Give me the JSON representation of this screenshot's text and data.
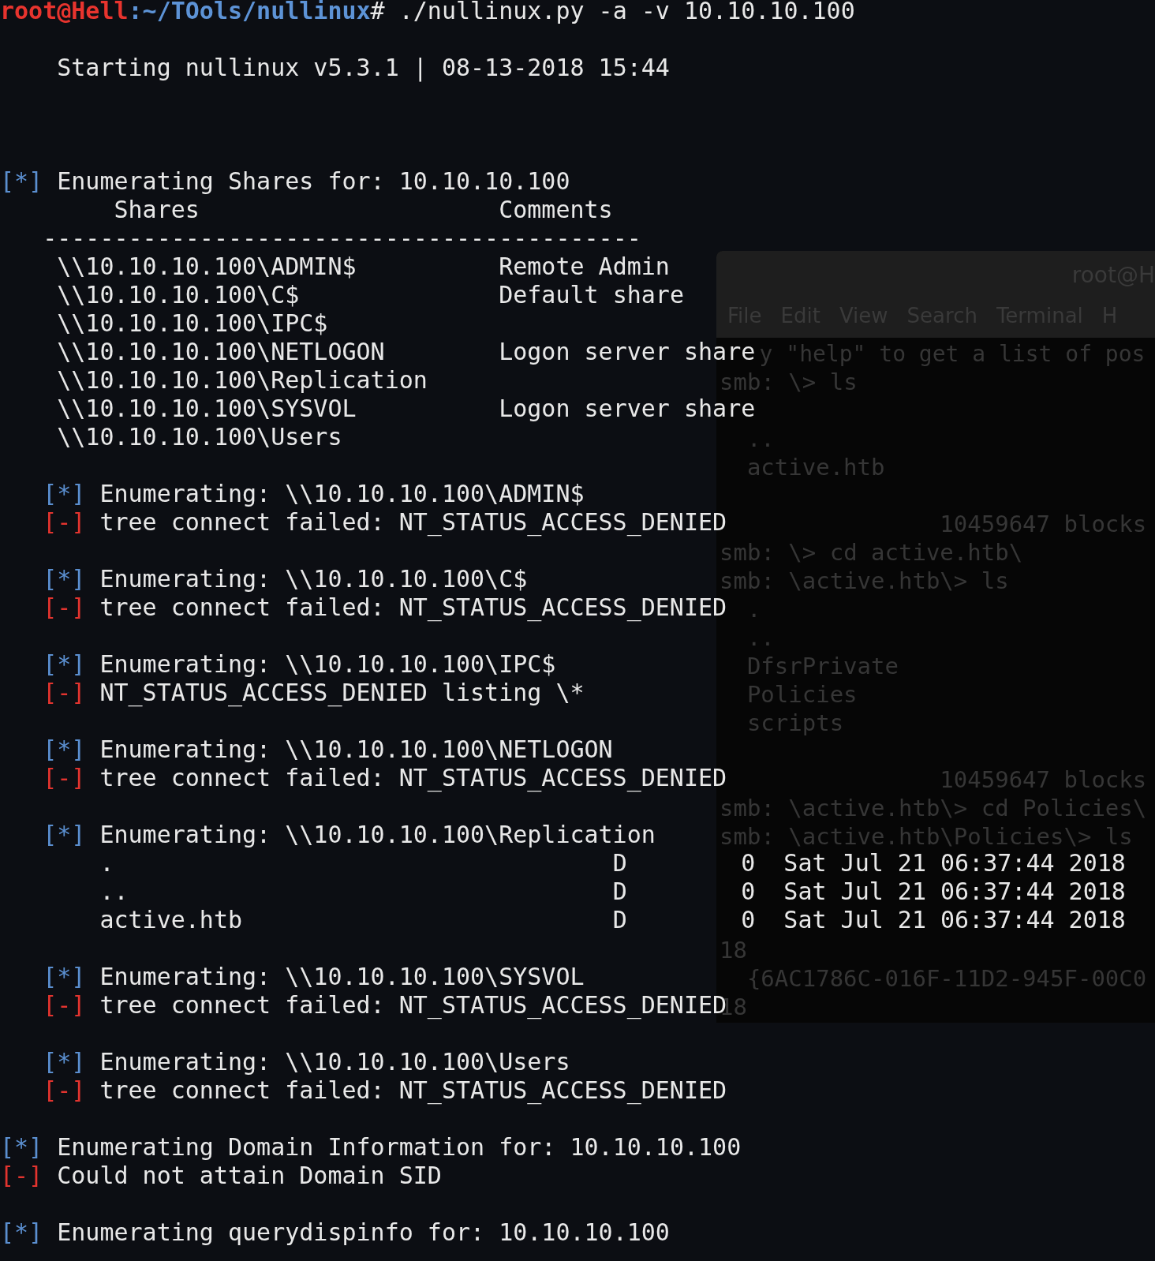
{
  "terminal": {
    "lines": [
      {
        "kind": "prompt",
        "user": "root@Hell",
        "path": ":~/TOols/nullinux",
        "command": "# ./nullinux.py -a -v 10.10.10.100"
      },
      {
        "kind": "blank"
      },
      {
        "kind": "banner",
        "text": "Starting nullinux v5.3.1 | 08-13-2018 15:44"
      },
      {
        "kind": "blank"
      },
      {
        "kind": "blank"
      },
      {
        "kind": "blank"
      },
      {
        "kind": "status",
        "error": false,
        "nested": false,
        "marker": "[*]",
        "text": "Enumerating Shares for: 10.10.10.100"
      },
      {
        "kind": "header",
        "columns": [
          "Shares",
          "Comments"
        ]
      },
      {
        "kind": "rule",
        "text": "------------------------------------------"
      },
      {
        "kind": "share",
        "share": "\\\\10.10.10.100\\ADMIN$",
        "comment": "Remote Admin"
      },
      {
        "kind": "share",
        "share": "\\\\10.10.10.100\\C$",
        "comment": "Default share"
      },
      {
        "kind": "share",
        "share": "\\\\10.10.10.100\\IPC$"
      },
      {
        "kind": "share",
        "share": "\\\\10.10.10.100\\NETLOGON",
        "comment": "Logon server share"
      },
      {
        "kind": "share",
        "share": "\\\\10.10.10.100\\Replication"
      },
      {
        "kind": "share",
        "share": "\\\\10.10.10.100\\SYSVOL",
        "comment": "Logon server share"
      },
      {
        "kind": "share",
        "share": "\\\\10.10.10.100\\Users"
      },
      {
        "kind": "blank"
      },
      {
        "kind": "status",
        "error": false,
        "nested": true,
        "marker": "[*]",
        "text": "Enumerating: \\\\10.10.10.100\\ADMIN$"
      },
      {
        "kind": "status",
        "error": true,
        "nested": true,
        "marker": "[-]",
        "text": "tree connect failed: NT_STATUS_ACCESS_DENIED"
      },
      {
        "kind": "blank"
      },
      {
        "kind": "status",
        "error": false,
        "nested": true,
        "marker": "[*]",
        "text": "Enumerating: \\\\10.10.10.100\\C$"
      },
      {
        "kind": "status",
        "error": true,
        "nested": true,
        "marker": "[-]",
        "text": "tree connect failed: NT_STATUS_ACCESS_DENIED"
      },
      {
        "kind": "blank"
      },
      {
        "kind": "status",
        "error": false,
        "nested": true,
        "marker": "[*]",
        "text": "Enumerating: \\\\10.10.10.100\\IPC$"
      },
      {
        "kind": "status",
        "error": true,
        "nested": true,
        "marker": "[-]",
        "text": "NT_STATUS_ACCESS_DENIED listing \\*"
      },
      {
        "kind": "blank"
      },
      {
        "kind": "status",
        "error": false,
        "nested": true,
        "marker": "[*]",
        "text": "Enumerating: \\\\10.10.10.100\\NETLOGON"
      },
      {
        "kind": "status",
        "error": true,
        "nested": true,
        "marker": "[-]",
        "text": "tree connect failed: NT_STATUS_ACCESS_DENIED"
      },
      {
        "kind": "blank"
      },
      {
        "kind": "status",
        "error": false,
        "nested": true,
        "marker": "[*]",
        "text": "Enumerating: \\\\10.10.10.100\\Replication"
      },
      {
        "kind": "entry",
        "name": ".",
        "attr": "D",
        "size": "0",
        "date": "Sat Jul 21 06:37:44 2018"
      },
      {
        "kind": "entry",
        "name": "..",
        "attr": "D",
        "size": "0",
        "date": "Sat Jul 21 06:37:44 2018"
      },
      {
        "kind": "entry",
        "name": "active.htb",
        "attr": "D",
        "size": "0",
        "date": "Sat Jul 21 06:37:44 2018"
      },
      {
        "kind": "blank"
      },
      {
        "kind": "status",
        "error": false,
        "nested": true,
        "marker": "[*]",
        "text": "Enumerating: \\\\10.10.10.100\\SYSVOL"
      },
      {
        "kind": "status",
        "error": true,
        "nested": true,
        "marker": "[-]",
        "text": "tree connect failed: NT_STATUS_ACCESS_DENIED"
      },
      {
        "kind": "blank"
      },
      {
        "kind": "status",
        "error": false,
        "nested": true,
        "marker": "[*]",
        "text": "Enumerating: \\\\10.10.10.100\\Users"
      },
      {
        "kind": "status",
        "error": true,
        "nested": true,
        "marker": "[-]",
        "text": "tree connect failed: NT_STATUS_ACCESS_DENIED"
      },
      {
        "kind": "blank"
      },
      {
        "kind": "status",
        "error": false,
        "nested": false,
        "marker": "[*]",
        "text": "Enumerating Domain Information for: 10.10.10.100"
      },
      {
        "kind": "status",
        "error": true,
        "nested": false,
        "marker": "[-]",
        "text": "Could not attain Domain SID"
      },
      {
        "kind": "blank"
      },
      {
        "kind": "status",
        "error": false,
        "nested": false,
        "marker": "[*]",
        "text": "Enumerating querydispinfo for: 10.10.10.100"
      }
    ]
  },
  "background_window": {
    "title": "root@H",
    "menu": [
      "File",
      "Edit",
      "View",
      "Search",
      "Terminal",
      "H"
    ],
    "lines": [
      {
        "kind": "partial",
        "text": "y \"help\" to get a list of pos"
      },
      {
        "kind": "command",
        "text": "smb: \\> ls"
      },
      {
        "kind": "blank"
      },
      {
        "kind": "item",
        "text": ".."
      },
      {
        "kind": "item",
        "text": "active.htb"
      },
      {
        "kind": "blank"
      },
      {
        "kind": "summary",
        "text": "10459647 blocks"
      },
      {
        "kind": "command",
        "text": "smb: \\> cd active.htb\\"
      },
      {
        "kind": "command",
        "text": "smb: \\active.htb\\> ls"
      },
      {
        "kind": "item",
        "text": "."
      },
      {
        "kind": "item",
        "text": ".."
      },
      {
        "kind": "item",
        "text": "DfsrPrivate"
      },
      {
        "kind": "item",
        "text": "Policies"
      },
      {
        "kind": "item",
        "text": "scripts"
      },
      {
        "kind": "blank"
      },
      {
        "kind": "summary",
        "text": "10459647 blocks"
      },
      {
        "kind": "command",
        "text": "smb: \\active.htb\\> cd Policies\\"
      },
      {
        "kind": "command",
        "text": "smb: \\active.htb\\Policies\\> ls"
      },
      {
        "kind": "blank"
      },
      {
        "kind": "blank"
      },
      {
        "kind": "blank"
      },
      {
        "kind": "command",
        "text": "18"
      },
      {
        "kind": "item",
        "text": "{6AC1786C-016F-11D2-945F-00C0"
      },
      {
        "kind": "command",
        "text": "18"
      }
    ]
  }
}
